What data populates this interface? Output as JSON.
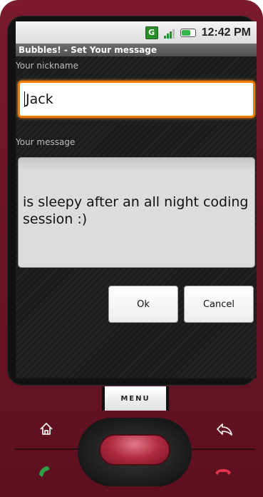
{
  "status_bar": {
    "g_badge": "G",
    "time": "12:42 PM",
    "icons": [
      "g-icon",
      "signal-icon",
      "battery-icon"
    ]
  },
  "window_title": "Bubbles! - Set Your message",
  "form": {
    "nickname_label": "Your nickname",
    "nickname_value": "Jack",
    "message_label": "Your message",
    "message_value": "is sleepy after an all night coding session :)"
  },
  "buttons": {
    "ok": "Ok",
    "cancel": "Cancel"
  },
  "hardware": {
    "menu_label": "MENU",
    "keys": [
      "home-icon",
      "back-icon",
      "call-icon",
      "end-call-icon"
    ]
  },
  "colors": {
    "device_body": "#6b1526",
    "focus_border": "#f57c00",
    "title_bar": "#5e5e5e"
  }
}
